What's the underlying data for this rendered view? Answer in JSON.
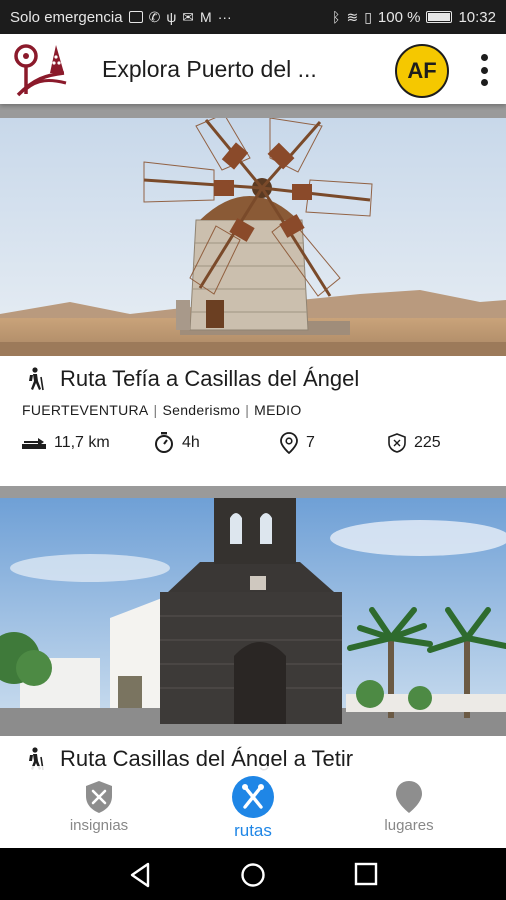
{
  "status_bar": {
    "carrier_text": "Solo emergencia",
    "battery_percent": "100 %",
    "time": "10:32"
  },
  "app_bar": {
    "title": "Explora Puerto del ...",
    "avatar_initials": "AF",
    "logo_icon": "app-logo-icon",
    "menu_icon": "more-vert-icon"
  },
  "routes": [
    {
      "title": "Ruta Tefía a Casillas del Ángel",
      "island": "FUERTEVENTURA",
      "activity": "Senderismo",
      "difficulty": "MEDIO",
      "distance": "11,7 km",
      "duration": "4h",
      "places": "7",
      "points": "225"
    },
    {
      "title": "Ruta Casillas del Ángel a Tetir"
    }
  ],
  "bottom_nav": {
    "items": [
      {
        "label": "insignias",
        "icon": "shield-tools-icon",
        "active": false
      },
      {
        "label": "rutas",
        "icon": "route-icon",
        "active": true
      },
      {
        "label": "lugares",
        "icon": "map-pin-icon",
        "active": false
      }
    ],
    "active_color": "#1f86e6",
    "inactive_color": "#888888"
  },
  "colors": {
    "brand": "#8b1a2b",
    "avatar_bg": "#f5c800"
  }
}
